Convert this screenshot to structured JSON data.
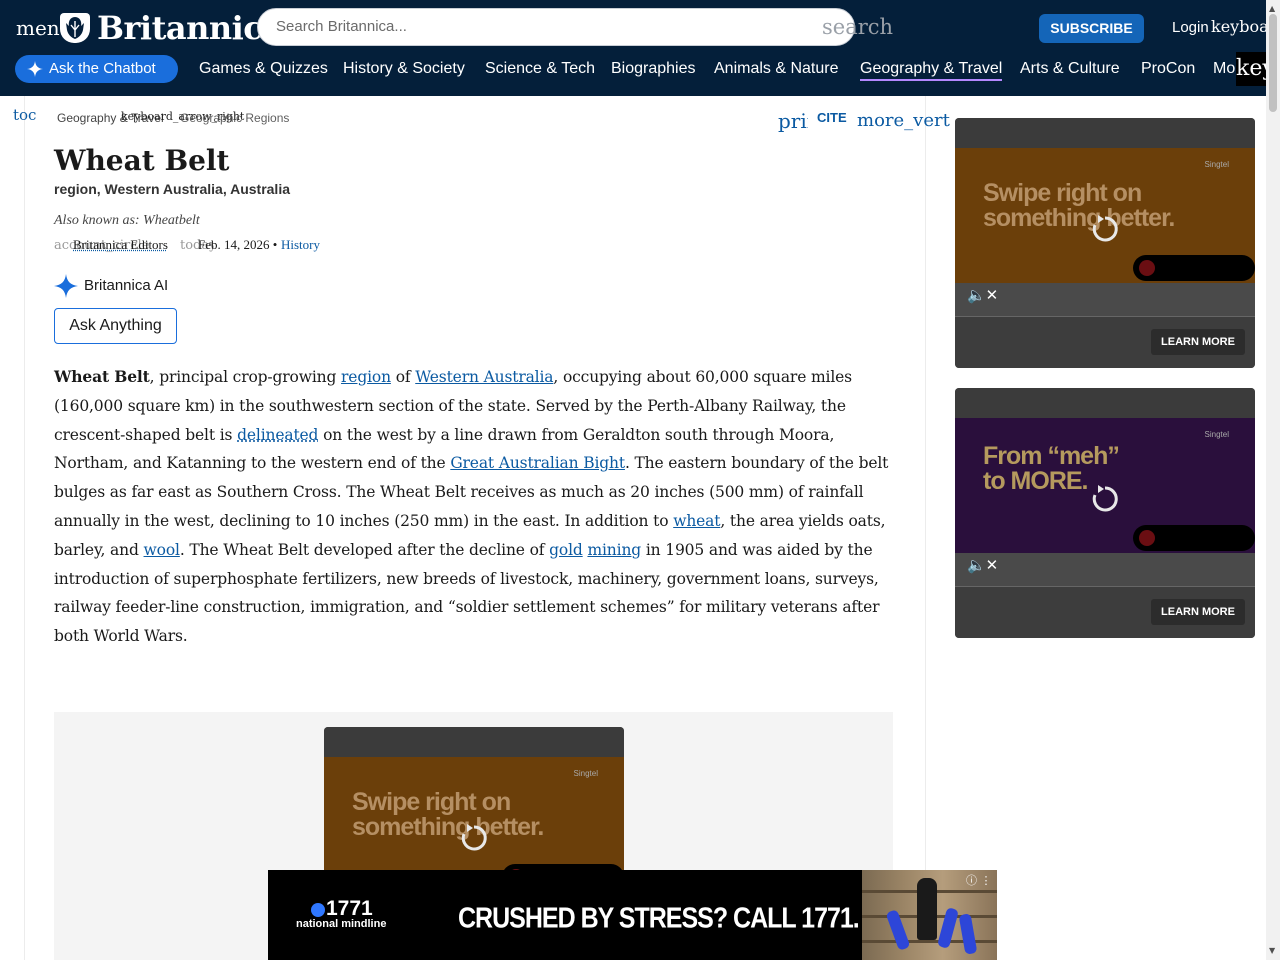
{
  "header": {
    "menu_label": "menu",
    "logo_text": "Britannica",
    "search_placeholder": "Search Britannica...",
    "search_icon_text": "search",
    "subscribe_label": "SUBSCRIBE",
    "login_label": "Login",
    "keyboard_text": "keyboard_arrow_down",
    "chatbot_label": "Ask the Chatbot",
    "nav_items": [
      "Games & Quizzes",
      "History & Society",
      "Science & Tech",
      "Biographies",
      "Animals & Nature",
      "Geography & Travel",
      "Arts & Culture",
      "ProCon",
      "Money"
    ],
    "nav_overflow_text": "keyboard_arrow_right",
    "active_nav": "Geography & Travel"
  },
  "article": {
    "toc_label": "toc",
    "breadcrumb_1": "Geography & Travel",
    "breadcrumb_sep": "keyboard_arrow_right",
    "breadcrumb_2": "Geographic Regions",
    "print_label": "print",
    "cite_label": "CITE",
    "more_label": "more_vert",
    "title": "Wheat Belt",
    "subtitle": "region, Western Australia, Australia",
    "also_known_as": "Also known as: Wheatbelt",
    "account_icon_text": "account_circle",
    "authors": "Britannica Editors",
    "today_icon_text": "today",
    "date": "Feb. 14, 2026",
    "bullet": "•",
    "history_link": "History",
    "ai_label": "Britannica AI",
    "ask_label": "Ask Anything",
    "body": {
      "bold_term": "Wheat Belt",
      "t1": ", principal crop-growing ",
      "l1": "region",
      "t2": " of ",
      "l2": "Western Australia",
      "t3": ", occupying about 60,000 square miles (160,000 square km) in the southwestern section of the state. Served by the Perth-Albany Railway, the crescent-shaped belt is ",
      "l3": "delineated",
      "t4": " on the west by a line drawn from Geraldton south through Moora, Northam, and Katanning to the western end of the ",
      "l4": "Great Australian Bight",
      "t5": ". The eastern boundary of the belt bulges as far east as Southern Cross. The Wheat Belt receives as much as 20 inches (500 mm) of rainfall annually in the west, declining to 10 inches (250 mm) in the east. In addition to ",
      "l5": "wheat",
      "t6": ", the area yields oats, barley, and ",
      "l6": "wool",
      "t7": ". The Wheat Belt developed after the decline of ",
      "l7": "gold",
      "t8": " ",
      "l8": "mining",
      "t9": " in 1905 and was aided by the introduction of superphosphate fertilizers, new breeds of livestock, machinery, government loans, surveys, railway feeder-line construction, immigration, and “soldier settlement schemes” for military veterans after both World Wars."
    }
  },
  "ads": {
    "ad1": {
      "headline_1": "Swipe right on",
      "headline_2": "something better.",
      "brand": "Singtel",
      "learn_more": "LEARN MORE",
      "color": "#6b3f0a",
      "text_color": "#b58f63"
    },
    "ad2": {
      "headline_1": "From “meh”",
      "headline_2": "to MORE.",
      "brand": "Singtel",
      "learn_more": "LEARN MORE",
      "color": "#2a0f3c",
      "text_color": "#b59a5e"
    },
    "ad3": {
      "headline_1": "Swipe right on",
      "headline_2": "something better.",
      "brand": "Singtel",
      "color": "#6b3f0a",
      "text_color": "#b58f63"
    },
    "banner": {
      "number": "1771",
      "sub": "national mindline",
      "headline": "CRUSHED BY STRESS? CALL 1771."
    }
  },
  "colors": {
    "header_bg": "#041f3a",
    "link": "#0b5aa2",
    "accent": "#1a6edc",
    "active_underline": "#b388ff"
  }
}
